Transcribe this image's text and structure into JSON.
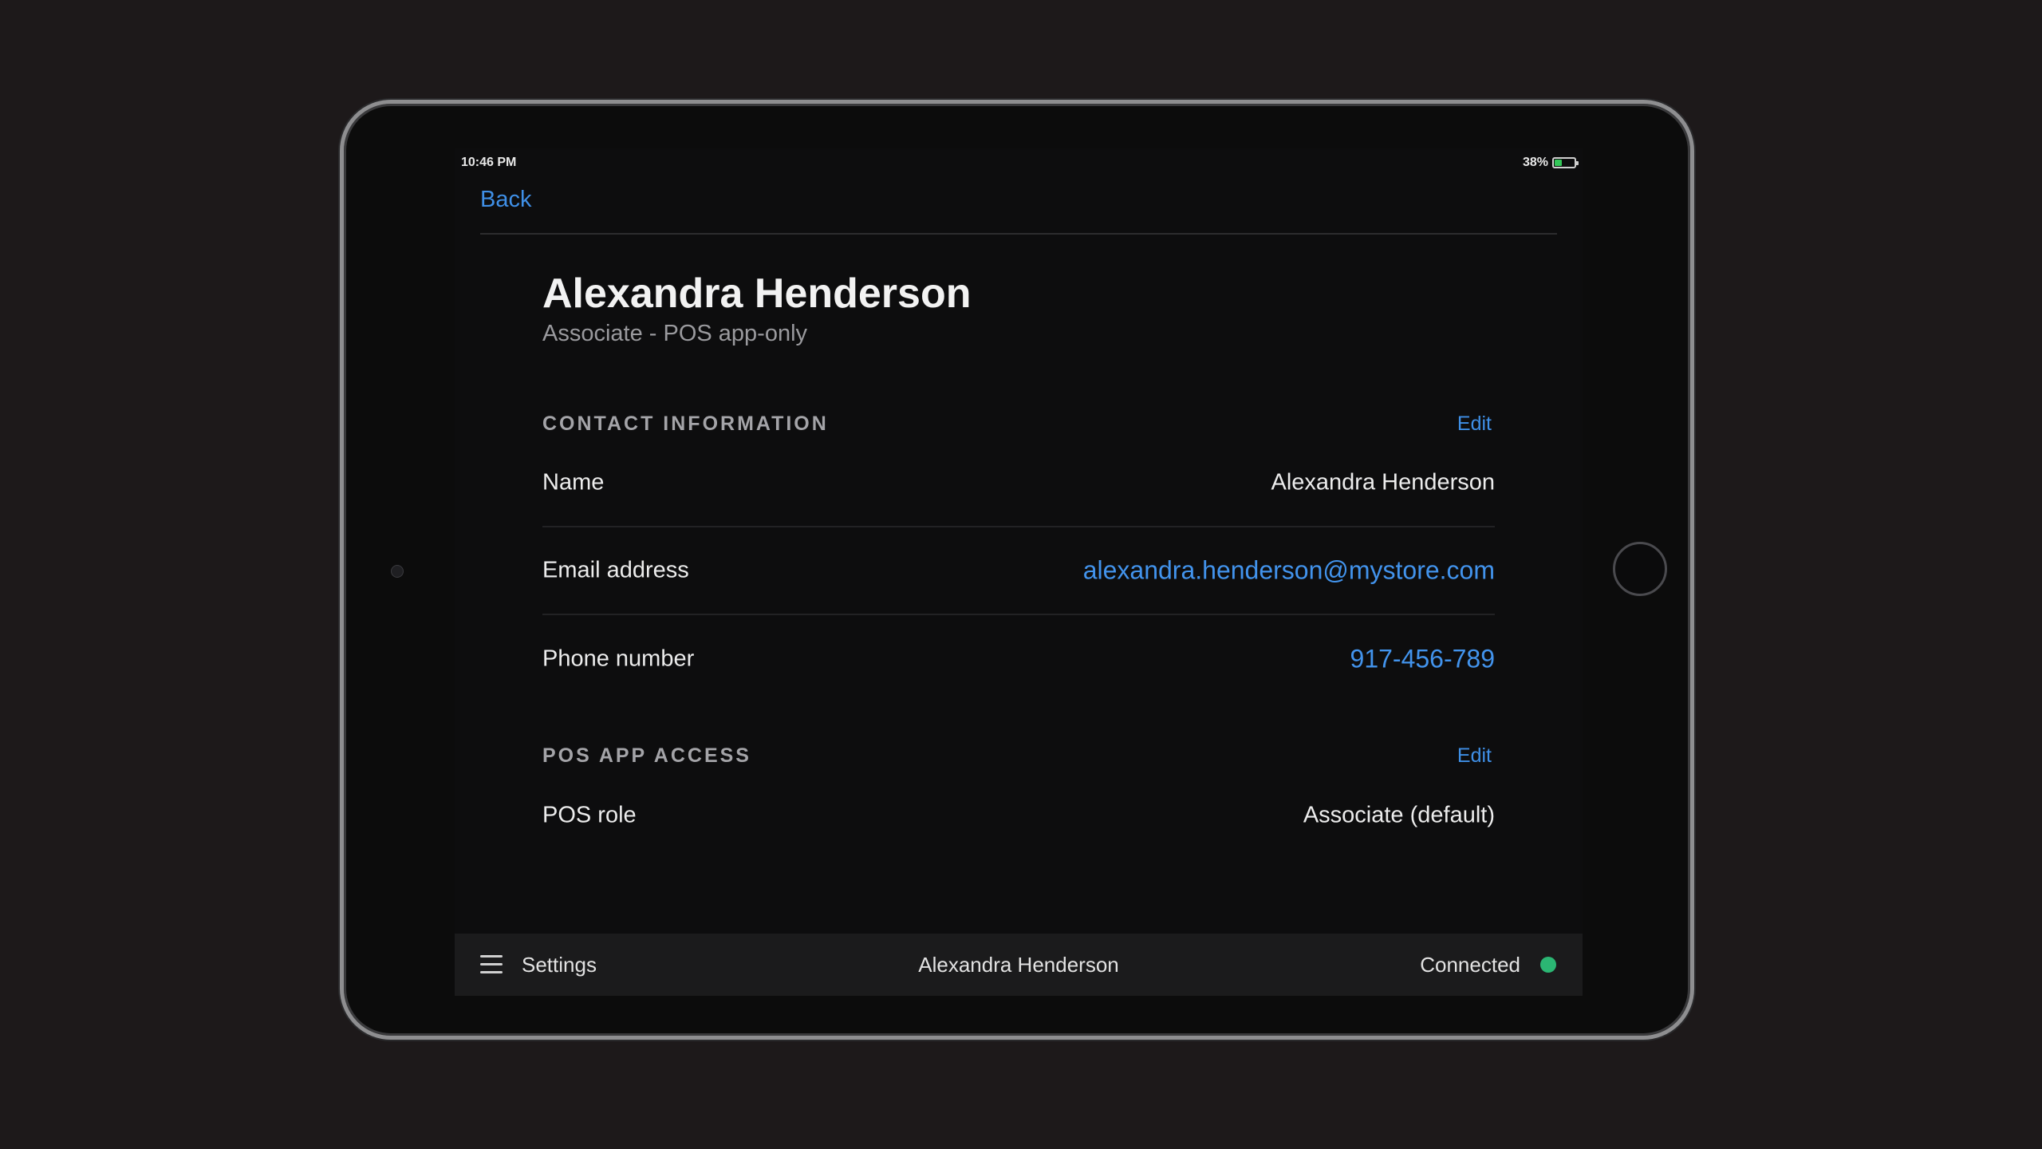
{
  "status_bar": {
    "time": "10:46 PM",
    "battery_percent": "38%",
    "battery_level": 0.38,
    "battery_color": "#34c759"
  },
  "nav": {
    "back_label": "Back"
  },
  "profile": {
    "name": "Alexandra Henderson",
    "role": "Associate - POS app-only"
  },
  "contact": {
    "title": "CONTACT INFORMATION",
    "edit_label": "Edit",
    "rows": [
      {
        "label": "Name",
        "value": "Alexandra Henderson"
      },
      {
        "label": "Email address",
        "value": "alexandra.henderson@mystore.com"
      },
      {
        "label": "Phone number",
        "value": "917-456-789"
      }
    ]
  },
  "pos_access": {
    "title": "POS APP ACCESS",
    "edit_label": "Edit",
    "rows": [
      {
        "label": "POS role",
        "value": "Associate (default)"
      }
    ]
  },
  "bottom_bar": {
    "menu_icon": "hamburger-menu-icon",
    "settings_label": "Settings",
    "current_user": "Alexandra Henderson",
    "connection_status": "Connected",
    "status_color": "#2bb673"
  },
  "theme": {
    "accent": "#3f8fe6",
    "background": "#0d0d0e"
  }
}
